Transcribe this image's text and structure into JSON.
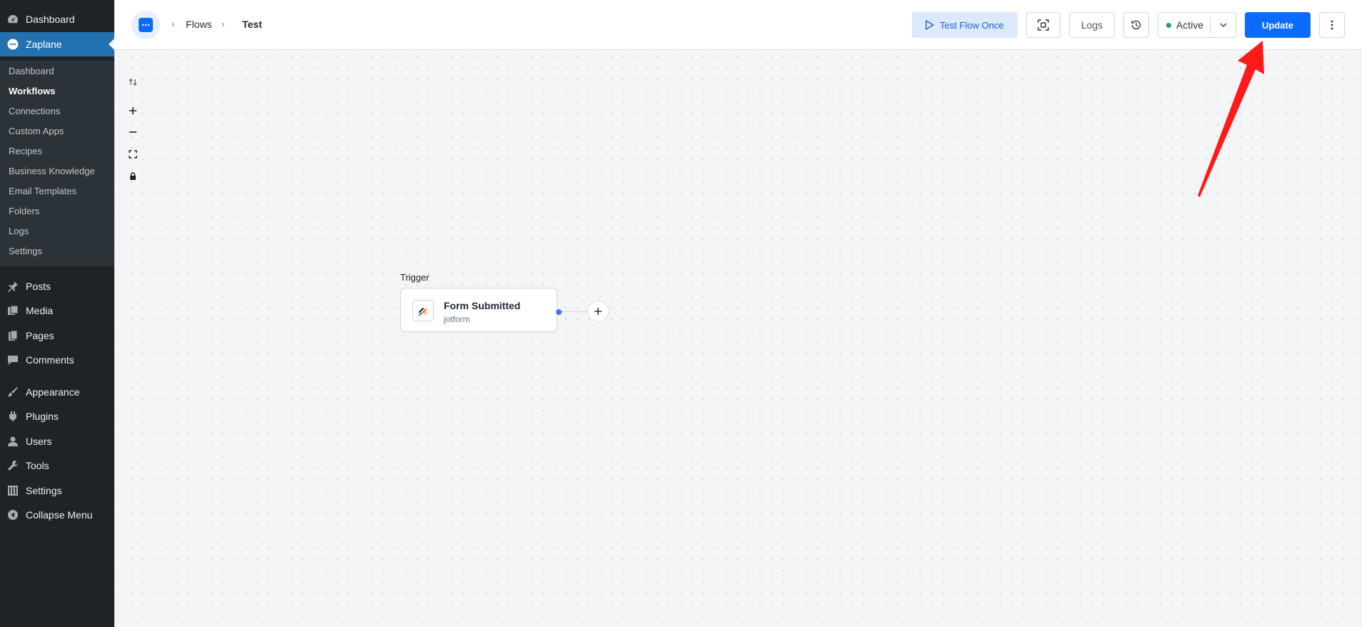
{
  "sidebar": {
    "top_items": [
      {
        "label": "Dashboard",
        "icon": "dashboard-icon"
      },
      {
        "label": "Zaplane",
        "icon": "zaplane-icon"
      }
    ],
    "submenu": [
      "Dashboard",
      "Workflows",
      "Connections",
      "Custom Apps",
      "Recipes",
      "Business Knowledge",
      "Email Templates",
      "Folders",
      "Logs",
      "Settings"
    ],
    "bottom_items": [
      {
        "label": "Posts",
        "icon": "pin-icon"
      },
      {
        "label": "Media",
        "icon": "media-icon"
      },
      {
        "label": "Pages",
        "icon": "pages-icon"
      },
      {
        "label": "Comments",
        "icon": "comment-icon"
      },
      {
        "label": "Appearance",
        "icon": "brush-icon"
      },
      {
        "label": "Plugins",
        "icon": "plugin-icon"
      },
      {
        "label": "Users",
        "icon": "user-icon"
      },
      {
        "label": "Tools",
        "icon": "wrench-icon"
      },
      {
        "label": "Settings",
        "icon": "settings-icon"
      },
      {
        "label": "Collapse Menu",
        "icon": "collapse-icon"
      }
    ],
    "active_item": "Zaplane",
    "current_submenu": "Workflows"
  },
  "header": {
    "breadcrumb": [
      "Flows",
      "Test"
    ],
    "test_button": "Test Flow Once",
    "logs_button": "Logs",
    "status": "Active",
    "status_color": "#22a06b",
    "update_button": "Update"
  },
  "canvas": {
    "trigger_label": "Trigger",
    "node_title": "Form Submitted",
    "node_app": "jotform"
  },
  "colors": {
    "accent": "#0b6bfd",
    "annotation_arrow": "#ff1a1a"
  }
}
